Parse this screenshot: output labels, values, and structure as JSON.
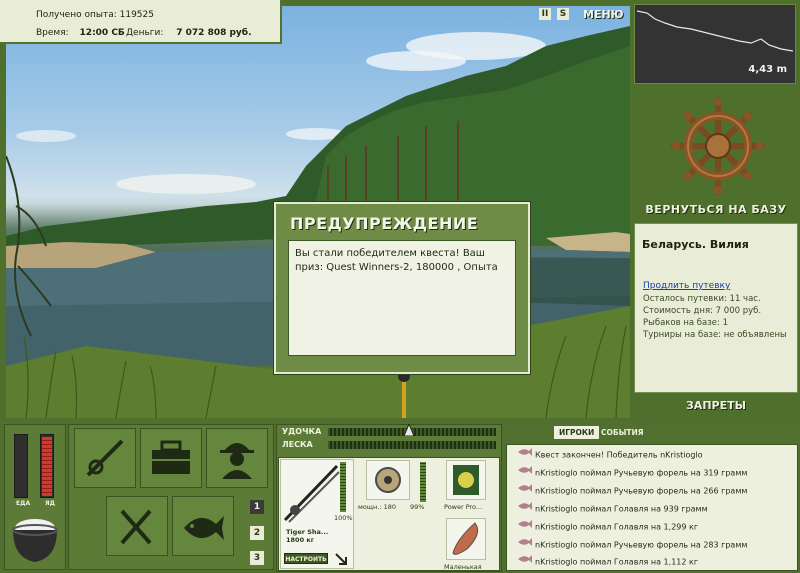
{
  "info": {
    "exp_label": "Получено опыта:",
    "exp_value": "119525",
    "time_label": "Время:",
    "time_value": "12:00 СБ",
    "money_label": "Деньги:",
    "money_value": "7 072 808 руб."
  },
  "top_controls": {
    "pause": "II",
    "sound": "S",
    "menu": "МЕНЮ"
  },
  "depth": {
    "value": "4,43 m"
  },
  "base_button": "ВЕРНУТЬСЯ НА БАЗУ",
  "location": {
    "title": "Беларусь. Вилия",
    "extend_link": "Продлить путевку",
    "lines": [
      "Осталось путевки: 11 час.",
      "Стоимость дня: 7 000 руб.",
      "Рыбаков на базе: 1",
      "Турниры на базе: не объявлены"
    ]
  },
  "bans_button": "ЗАПРЕТЫ",
  "dialog": {
    "title": "ПРЕДУПРЕЖДЕНИЕ",
    "message": "Вы стали победителем квеста! Ваш приз: Quest Winners-2, 180000 , Опыта"
  },
  "meters": {
    "food_label": "ЕДА",
    "poison_label": "ЯД",
    "food_level": 0.0,
    "poison_level": 0.95
  },
  "pages": [
    "1",
    "2",
    "3"
  ],
  "tackle": {
    "rod_label": "УДОЧКА",
    "line_label": "ЛЕСКА",
    "rod_name": "Tiger Sha...",
    "rod_weight": "1800 кг",
    "rod_percent": "100%",
    "reel_power": "мощн.: 180",
    "reel_percent": "99%",
    "line_name": "Power Pro...",
    "lure_name": "Маленькая",
    "setup_button": "НАСТРОИТЬ"
  },
  "feed": {
    "tabs": [
      "ИГРОКИ",
      "СОБЫТИЯ"
    ],
    "rows": [
      "Квест закончен! Победитель nKristioglo",
      "nKristioglo поймал Ручьевую форель на 319 грамм",
      "nKristioglo поймал Ручьевую форель на 266 грамм",
      "nKristioglo поймал Голавля на 939 грамм",
      "nKristioglo поймал Голавля на 1,299 кг",
      "nKristioglo поймал Ручьевую форель на 283 грамм",
      "nKristioglo поймал Голавля на 1,112 кг"
    ]
  },
  "colors": {
    "panel": "#4f6f2d",
    "paper": "#e9ecd6",
    "accent_red": "#c03025"
  }
}
